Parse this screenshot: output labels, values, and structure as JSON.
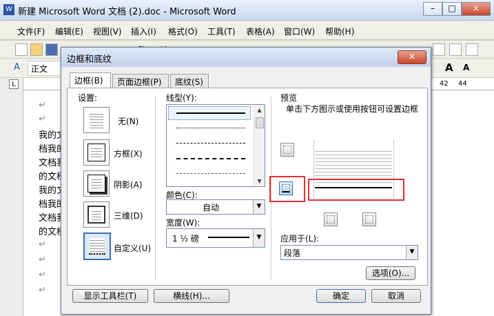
{
  "window": {
    "title": "新建 Microsoft Word 文档 (2).doc - Microsoft Word",
    "min_glyph": "–",
    "max_glyph": "□",
    "close_glyph": "×"
  },
  "menu": [
    "文件(F)",
    "编辑(E)",
    "视图(V)",
    "插入(I)",
    "格式(O)",
    "工具(T)",
    "表格(A)",
    "窗口(W)",
    "帮助(H)"
  ],
  "toolbar": {
    "style_value": "正文",
    "partial_labels": [
      "繁",
      "较"
    ],
    "font_grow": "A",
    "font_shrink": "A"
  },
  "ruler": {
    "left_marker": "L",
    "marks": [
      "42",
      "44"
    ]
  },
  "document": {
    "lines": [
      "我的文",
      "档我的",
      "文档我",
      "的文档",
      "我的文",
      "档我的",
      "文档我",
      "的文档"
    ],
    "para_mark": "↵"
  },
  "dialog": {
    "title": "边框和底纹",
    "close_glyph": "×",
    "tabs": [
      "边框(B)",
      "页面边框(P)",
      "底纹(S)"
    ],
    "settings_label": "设置:",
    "settings": [
      "无(N)",
      "方框(X)",
      "阴影(A)",
      "三维(D)",
      "自定义(U)"
    ],
    "line_style_label": "线型(Y):",
    "color_label": "颜色(C):",
    "color_value": "自动",
    "width_label": "宽度(W):",
    "width_value": "1 ½ 磅",
    "preview_label": "预览",
    "preview_hint": "单击下方图示或使用按钮可设置边框",
    "apply_label": "应用于(L):",
    "apply_value": "段落",
    "options_button": "选项(O)...",
    "toolbar_button": "显示工具栏(T)",
    "hline_button": "横线(H)...",
    "ok_button": "确定",
    "cancel_button": "取消"
  },
  "colors": {
    "highlight": "#e03030",
    "selected_setting": "#3a6fb0"
  }
}
